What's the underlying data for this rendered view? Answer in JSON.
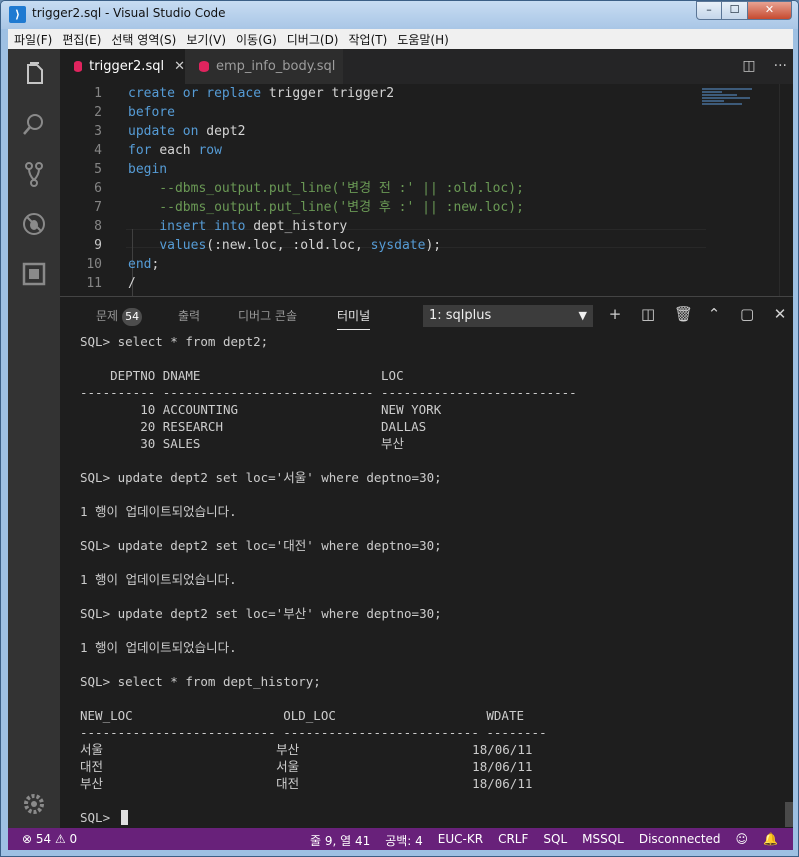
{
  "window": {
    "title": "trigger2.sql - Visual Studio Code",
    "min": "–",
    "max": "☐",
    "close": "✕"
  },
  "menu": [
    "파일(F)",
    "편집(E)",
    "선택 영역(S)",
    "보기(V)",
    "이동(G)",
    "디버그(D)",
    "작업(T)",
    "도움말(H)"
  ],
  "tabs": [
    {
      "label": "trigger2.sql",
      "close": "✕"
    },
    {
      "label": "emp_info_body.sql"
    }
  ],
  "tab_actions": {
    "split": "◫",
    "more": "···"
  },
  "editor": {
    "line_numbers": [
      "1",
      "2",
      "3",
      "4",
      "5",
      "6",
      "7",
      "8",
      "9",
      "10",
      "11"
    ],
    "lines": [
      {
        "a": "create",
        "b": " ",
        "c": "or",
        "d": " ",
        "e": "replace",
        "f": " trigger trigger2"
      },
      {
        "a": "before"
      },
      {
        "a": "update",
        "b": " ",
        "c": "on",
        "d": " dept2"
      },
      {
        "a": "for",
        "b": " ",
        "c": "each",
        "d": " ",
        "e": "row"
      },
      {
        "a": "begin"
      },
      {
        "a": "    --dbms_output.put_line('변경 전 :' || :old.loc);"
      },
      {
        "a": "    --dbms_output.put_line('변경 후 :' || :new.loc);"
      },
      {
        "a": "    ",
        "b": "insert",
        "c": " ",
        "d": "into",
        "e": " dept_history"
      },
      {
        "a": "    ",
        "b": "values",
        "c": "(:new.loc, :old.loc, ",
        "d": "sysdate",
        "e": ");"
      },
      {
        "a": "end",
        "b": ";"
      },
      {
        "a": "/"
      }
    ]
  },
  "panel": {
    "tabs": {
      "problems": "문제",
      "problems_count": "54",
      "output": "출력",
      "debug": "디버그 콘솔",
      "terminal": "터미널"
    },
    "terminal_select": "1: sqlplus",
    "select_arrow": "▼",
    "actions": {
      "add": "+",
      "split": "◫",
      "trash": "🗑",
      "up": "⌃",
      "maximize": "▢",
      "close": "✕"
    }
  },
  "terminal_lines": [
    "SQL> select * from dept2;",
    "",
    "    DEPTNO DNAME                        LOC",
    "---------- ---------------------------- --------------------------",
    "        10 ACCOUNTING                   NEW YORK",
    "        20 RESEARCH                     DALLAS",
    "        30 SALES                        부산",
    "",
    "SQL> update dept2 set loc='서울' where deptno=30;",
    "",
    "1 행이 업데이트되었습니다.",
    "",
    "SQL> update dept2 set loc='대전' where deptno=30;",
    "",
    "1 행이 업데이트되었습니다.",
    "",
    "SQL> update dept2 set loc='부산' where deptno=30;",
    "",
    "1 행이 업데이트되었습니다.",
    "",
    "SQL> select * from dept_history;",
    "",
    "NEW_LOC                    OLD_LOC                    WDATE",
    "-------------------------- -------------------------- --------",
    "서울                       부산                       18/06/11",
    "대전                       서울                       18/06/11",
    "부산                       대전                       18/06/11",
    "",
    "SQL> "
  ],
  "statusbar": {
    "errors": "⊗ 54",
    "warnings": "⚠ 0",
    "position": "줄 9, 열 41",
    "spaces": "공백: 4",
    "encoding": "EUC-KR",
    "eol": "CRLF",
    "language": "SQL",
    "server": "MSSQL",
    "connection": "Disconnected",
    "feedback": "☺",
    "bell": "🔔"
  },
  "colors": {
    "statusbar": "#68217a",
    "editor_bg": "#1e1e1e",
    "keyword": "#569cd6",
    "comment": "#6a9955"
  }
}
